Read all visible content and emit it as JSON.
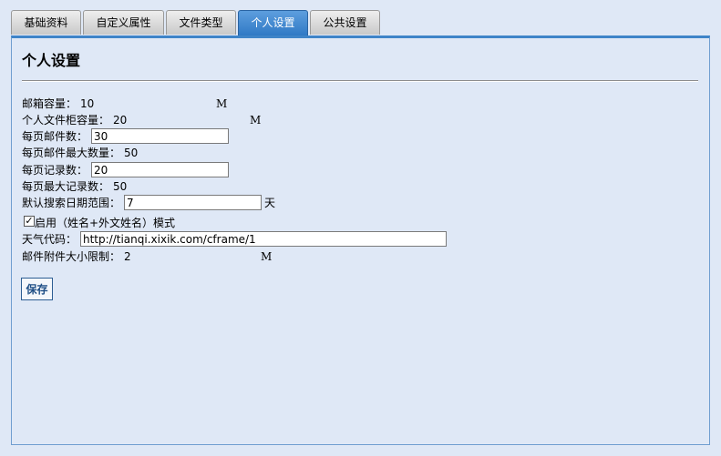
{
  "tabs": [
    {
      "label": "基础资料"
    },
    {
      "label": "自定义属性"
    },
    {
      "label": "文件类型"
    },
    {
      "label": "个人设置"
    },
    {
      "label": "公共设置"
    }
  ],
  "page": {
    "title": "个人设置"
  },
  "settings": {
    "mailbox_capacity": {
      "label": "邮箱容量：",
      "value": "10",
      "unit": "M"
    },
    "cabinet_capacity": {
      "label": "个人文件柜容量：",
      "value": "20",
      "unit": "M"
    },
    "mails_per_page": {
      "label": "每页邮件数：",
      "value": "30"
    },
    "max_mails_per_page": {
      "label": "每页邮件最大数量：",
      "value": "50"
    },
    "records_per_page": {
      "label": "每页记录数：",
      "value": "20"
    },
    "max_records_per_page": {
      "label": "每页最大记录数：",
      "value": "50"
    },
    "default_search_range": {
      "label": "默认搜索日期范围：",
      "value": "7",
      "unit": "天"
    },
    "enable_name_mode": {
      "label": "启用（姓名+外文姓名）模式",
      "checked": true
    },
    "weather_code": {
      "label": "天气代码：",
      "value": "http://tianqi.xixik.com/cframe/1"
    },
    "attachment_limit": {
      "label": "邮件附件大小限制：",
      "value": "2",
      "unit": "M"
    }
  },
  "buttons": {
    "save": "保存"
  },
  "colors": {
    "active_tab": "#3a86d0",
    "background": "#dfe8f6",
    "panel_border": "#3f84c8"
  }
}
